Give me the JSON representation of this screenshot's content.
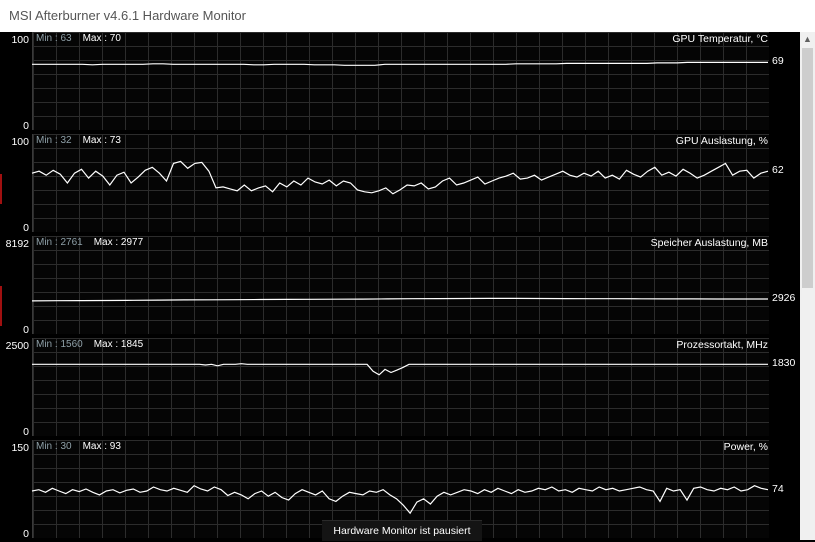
{
  "window": {
    "title": "MSI Afterburner v4.6.1 Hardware Monitor"
  },
  "status": {
    "paused": "Hardware Monitor ist pausiert"
  },
  "panels": [
    {
      "label": "GPU Temperatur, °C",
      "min_text": "Min : 63",
      "max_text": "Max : 70",
      "ymax": "100",
      "ymin": "0",
      "current": "69",
      "range": [
        0,
        100
      ],
      "samples": [
        67,
        67,
        67,
        67,
        67,
        67,
        66.5,
        67,
        67,
        67,
        67,
        67,
        67.5,
        67.5,
        67,
        67,
        67,
        67,
        67,
        67,
        67,
        67,
        66.5,
        66.5,
        67,
        67,
        67,
        67,
        66.5,
        66.5,
        66.5,
        66,
        66,
        66,
        66,
        67,
        67,
        67,
        67,
        67,
        67,
        67,
        67,
        67,
        67,
        67,
        67,
        67,
        67.5,
        67.5,
        67.5,
        67.5,
        67.5,
        68,
        68,
        68,
        68,
        68,
        68,
        68,
        68,
        68,
        68.5,
        68.5,
        68.5,
        69,
        69,
        69,
        69,
        69,
        69,
        69,
        69,
        69
      ]
    },
    {
      "label": "GPU Auslastung, %",
      "min_text": "Min : 32",
      "max_text": "Max : 73",
      "ymax": "100",
      "ymin": "0",
      "current": "62",
      "range": [
        0,
        100
      ],
      "samples": [
        60,
        62,
        58,
        63,
        59,
        50,
        60,
        64,
        55,
        62,
        57,
        48,
        58,
        61,
        50,
        56,
        63,
        66,
        60,
        52,
        70,
        72,
        65,
        70,
        71,
        62,
        45,
        46,
        44,
        42,
        48,
        42,
        45,
        47,
        41,
        50,
        46,
        52,
        48,
        55,
        51,
        49,
        53,
        47,
        52,
        50,
        43,
        41,
        40,
        42,
        45,
        39,
        43,
        48,
        47,
        50,
        44,
        46,
        52,
        55,
        48,
        50,
        53,
        56,
        49,
        52,
        55,
        57,
        60,
        54,
        55,
        58,
        53,
        56,
        59,
        62,
        58,
        56,
        60,
        57,
        62,
        55,
        58,
        54,
        63,
        59,
        56,
        62,
        66,
        58,
        61,
        57,
        64,
        60,
        55,
        58,
        62,
        66,
        70,
        58,
        62,
        63,
        55,
        60,
        62
      ]
    },
    {
      "label": "Speicher Auslastung, MB",
      "min_text": "Min : 2761",
      "max_text": "Max : 2977",
      "ymax": "8192",
      "ymin": "0",
      "current": "2926",
      "range": [
        0,
        8192
      ],
      "samples": [
        2770,
        2780,
        2790,
        2800,
        2820,
        2830,
        2850,
        2860,
        2870,
        2880,
        2890,
        2900,
        2910,
        2920,
        2930,
        2950,
        2960,
        2970,
        2975,
        2977,
        2970,
        2960,
        2950,
        2950,
        2940,
        2930,
        2930,
        2926,
        2926,
        2926
      ]
    },
    {
      "label": "Prozessortakt, MHz",
      "min_text": "Min : 1560",
      "max_text": "Max : 1845",
      "ymax": "2500",
      "ymin": "0",
      "current": "1830",
      "range": [
        0,
        2500
      ],
      "samples": [
        1830,
        1830,
        1830,
        1830,
        1830,
        1830,
        1830,
        1830,
        1830,
        1830,
        1830,
        1830,
        1830,
        1830,
        1830,
        1830,
        1830,
        1830,
        1830,
        1830,
        1830,
        1830,
        1830,
        1830,
        1830,
        1830,
        1830,
        1830,
        1830,
        1810,
        1830,
        1790,
        1830,
        1830,
        1830,
        1845,
        1830,
        1830,
        1830,
        1830,
        1830,
        1830,
        1830,
        1830,
        1830,
        1830,
        1830,
        1830,
        1830,
        1830,
        1830,
        1830,
        1830,
        1830,
        1830,
        1830,
        1830,
        1650,
        1560,
        1700,
        1620,
        1680,
        1750,
        1830,
        1830,
        1830,
        1830,
        1830,
        1830,
        1830,
        1830,
        1830,
        1830,
        1830,
        1830,
        1830,
        1830,
        1830,
        1830,
        1830,
        1830,
        1830,
        1830,
        1830,
        1830,
        1830,
        1830,
        1830,
        1830,
        1830,
        1830,
        1830,
        1830,
        1830,
        1830,
        1830,
        1830,
        1830,
        1830,
        1830,
        1830,
        1830,
        1830,
        1830,
        1830,
        1830,
        1830,
        1830,
        1830,
        1830,
        1830,
        1830,
        1830,
        1830,
        1830,
        1830,
        1830,
        1830,
        1830,
        1830,
        1830,
        1830,
        1830,
        1830
      ]
    },
    {
      "label": "Power, %",
      "min_text": "Min : 30",
      "max_text": "Max : 93",
      "ymax": "150",
      "ymin": "0",
      "current": "74",
      "range": [
        0,
        150
      ],
      "samples": [
        72,
        74,
        70,
        76,
        72,
        68,
        74,
        71,
        75,
        70,
        66,
        72,
        74,
        69,
        73,
        75,
        70,
        72,
        78,
        74,
        72,
        76,
        73,
        70,
        80,
        75,
        72,
        78,
        74,
        65,
        70,
        66,
        60,
        68,
        72,
        64,
        70,
        62,
        58,
        68,
        74,
        70,
        66,
        72,
        60,
        56,
        64,
        70,
        68,
        66,
        72,
        70,
        74,
        66,
        60,
        50,
        38,
        55,
        60,
        52,
        64,
        70,
        66,
        70,
        74,
        72,
        68,
        74,
        70,
        76,
        72,
        68,
        74,
        70,
        72,
        76,
        74,
        78,
        72,
        74,
        70,
        76,
        74,
        72,
        78,
        74,
        76,
        72,
        74,
        76,
        78,
        74,
        72,
        56,
        76,
        72,
        74,
        58,
        76,
        78,
        74,
        72,
        76,
        74,
        78,
        72,
        74,
        80,
        76,
        74
      ]
    }
  ]
}
